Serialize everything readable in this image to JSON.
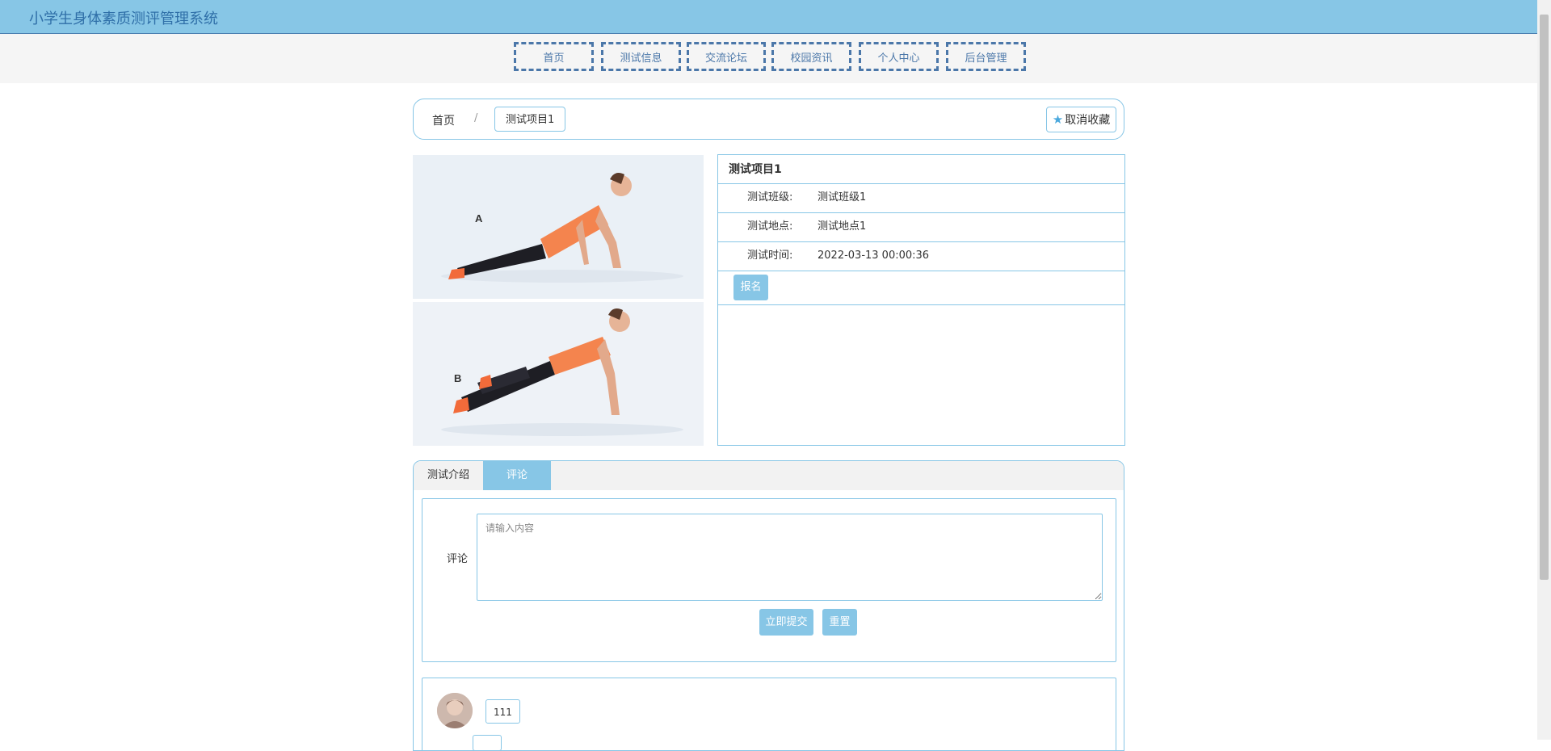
{
  "header": {
    "title": "小学生身体素质测评管理系统"
  },
  "nav": {
    "items": [
      {
        "label": "首页"
      },
      {
        "label": "测试信息"
      },
      {
        "label": "交流论坛"
      },
      {
        "label": "校园资讯"
      },
      {
        "label": "个人中心"
      },
      {
        "label": "后台管理"
      }
    ]
  },
  "breadcrumb": {
    "home": "首页",
    "separator": "/",
    "current": "测试项目1"
  },
  "favorite": {
    "label": "取消收藏"
  },
  "detail": {
    "title": "测试项目1",
    "rows": [
      {
        "label": "测试班级:",
        "value": "测试班级1"
      },
      {
        "label": "测试地点:",
        "value": "测试地点1"
      },
      {
        "label": "测试时间:",
        "value": "2022-03-13 00:00:36"
      }
    ],
    "signup_label": "报名",
    "image_labels": {
      "top": "A",
      "bottom": "B"
    }
  },
  "tabs": [
    {
      "label": "测试介绍"
    },
    {
      "label": "评论"
    }
  ],
  "comment_form": {
    "label": "评论",
    "placeholder": "请输入内容",
    "submit_label": "立即提交",
    "reset_label": "重置"
  },
  "comments": [
    {
      "text": "111"
    }
  ],
  "colors": {
    "primary": "#87c6e6",
    "nav_border": "#4b77a9",
    "title_text": "#2f6fa8"
  }
}
